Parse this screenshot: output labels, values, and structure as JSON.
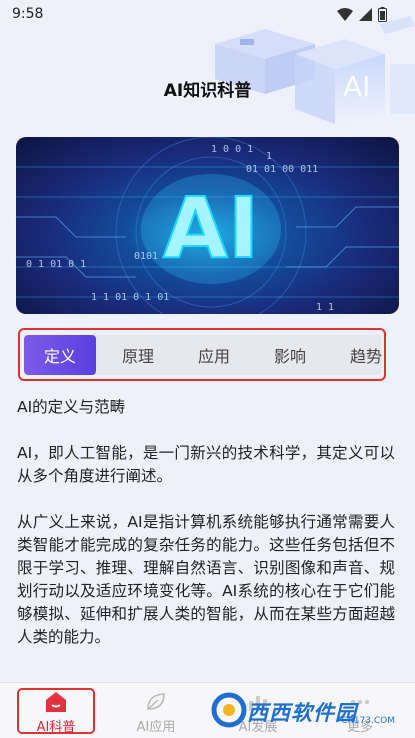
{
  "status_bar": {
    "time": "9:58"
  },
  "header": {
    "title": "AI知识科普",
    "art_text": "AI"
  },
  "hero": {
    "big_text": "AI",
    "binary_snippets": [
      "1 0  0 1",
      "1",
      "01 01  00 011",
      "0  1   01  0  1",
      "0101",
      "1 1    01 0 1 01",
      "1  1"
    ]
  },
  "tabs": [
    {
      "label": "定义",
      "active": true
    },
    {
      "label": "原理",
      "active": false
    },
    {
      "label": "应用",
      "active": false
    },
    {
      "label": "影响",
      "active": false
    },
    {
      "label": "趋势",
      "active": false
    }
  ],
  "content": {
    "heading": "AI的定义与范畴",
    "p1": "AI，即人工智能，是一门新兴的技术科学，其定义可以从多个角度进行阐述。",
    "p2": "从广义上来说，AI是指计算机系统能够执行通常需要人类智能才能完成的复杂任务的能力。这些任务包括但不限于学习、推理、理解自然语言、识别图像和声音、规划行动以及适应环境变化等。AI系统的核心在于它们能够模拟、延伸和扩展人类的智能，从而在某些方面超越人类的能力。"
  },
  "bottom_nav": [
    {
      "label": "AI科普",
      "icon": "home-icon",
      "active": true
    },
    {
      "label": "AI应用",
      "icon": "leaf-icon",
      "active": false
    },
    {
      "label": "AI发展",
      "icon": "chart-icon",
      "active": false
    },
    {
      "label": "更多",
      "icon": "more-icon",
      "active": false
    }
  ],
  "watermark": {
    "text": "西西软件园",
    "url": "CR173.COM"
  },
  "colors": {
    "accent": "#5a3fe0",
    "nav_active": "#d8283b",
    "highlight_border": "#dd3333",
    "background": "#eef1fb"
  }
}
